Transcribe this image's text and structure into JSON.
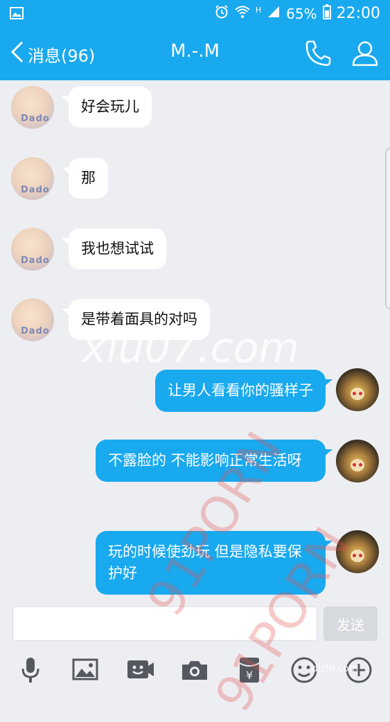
{
  "status_bar": {
    "battery_percent": "65%",
    "time": "22:00",
    "network_label": "H",
    "icons": [
      "image-notification-icon",
      "alarm-icon",
      "wifi-icon",
      "signal-icon",
      "battery-icon"
    ]
  },
  "nav": {
    "back_label": "消息(96)",
    "title": "M.-.M",
    "call_icon": "phone-icon",
    "profile_icon": "person-icon"
  },
  "messages": [
    {
      "side": "in",
      "text": "好会玩儿"
    },
    {
      "side": "in",
      "text": "那"
    },
    {
      "side": "in",
      "text": "我也想试试"
    },
    {
      "side": "in",
      "text": "是带着面具的对吗"
    },
    {
      "side": "out",
      "text": "让男人看看你的骚样子"
    },
    {
      "side": "out",
      "text": "不露脸的 不能影响正常生活呀"
    },
    {
      "side": "out",
      "text": "玩的时候使劲玩 但是隐私要保护好"
    }
  ],
  "avatar_text": "Dado",
  "input": {
    "value": "",
    "placeholder": ""
  },
  "send_label": "发送",
  "toolbar_icons": [
    "microphone-icon",
    "image-icon",
    "video-icon",
    "camera-icon",
    "red-packet-icon",
    "emoji-icon",
    "plus-icon"
  ],
  "watermarks": {
    "top": "xiu07.com",
    "diag1": "91PORN",
    "diag2": "91PORN",
    "bottom": "dizhi.com"
  },
  "colors": {
    "accent": "#19a9ef",
    "background": "#eceef2",
    "bubble_in": "#ffffff",
    "bubble_out": "#19a9ef"
  }
}
